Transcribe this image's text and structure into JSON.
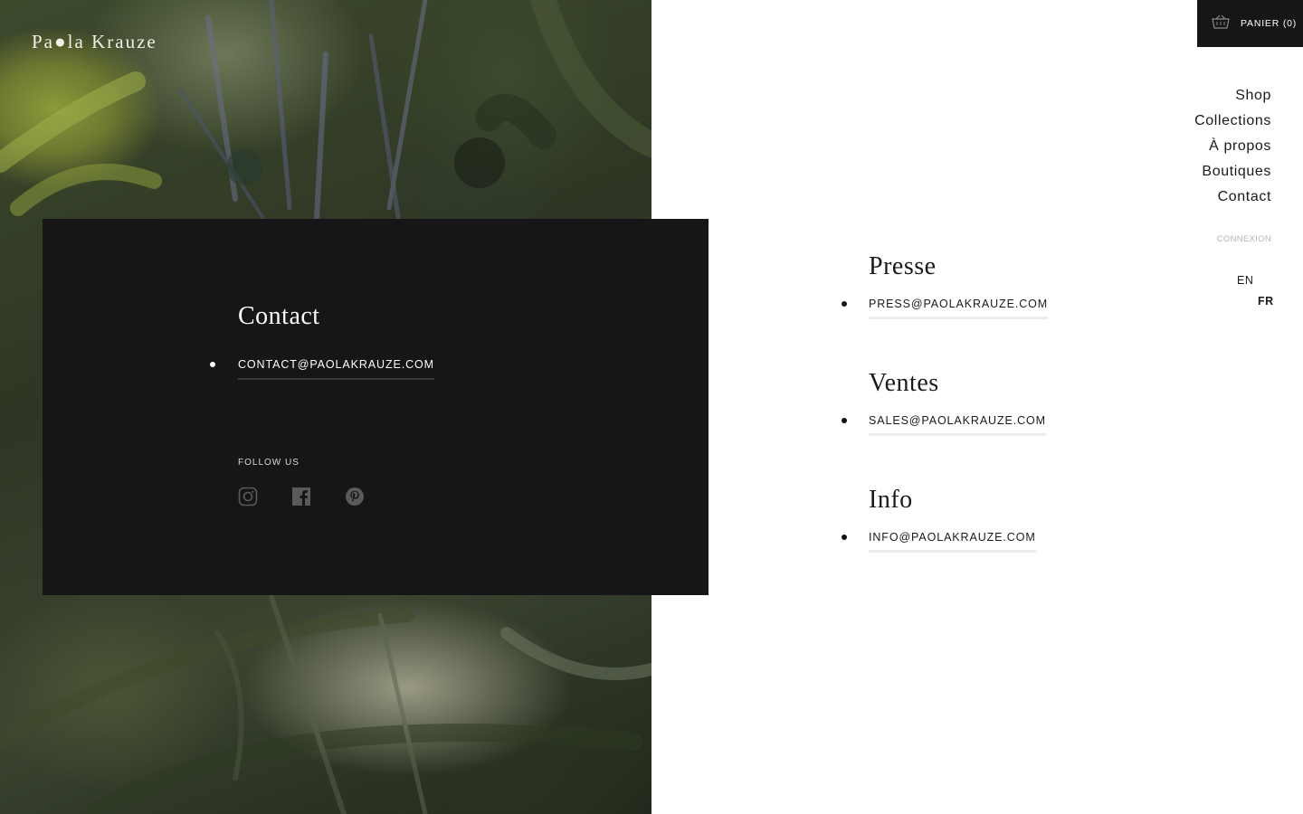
{
  "brand": {
    "logo_text": "Pa●la Krauze"
  },
  "cart": {
    "label": "PANIER (0)",
    "icon": "basket-icon"
  },
  "nav": {
    "items": [
      "Shop",
      "Collections",
      "À propos",
      "Boutiques",
      "Contact"
    ]
  },
  "account": {
    "login_label": "CONNEXION"
  },
  "languages": {
    "en": "EN",
    "fr": "FR",
    "active": "FR"
  },
  "contact_card": {
    "title": "Contact",
    "email": "CONTACT@PAOLAKRAUZE.COM",
    "follow_label": "FOLLOW US",
    "socials": [
      "instagram-icon",
      "facebook-icon",
      "pinterest-icon"
    ]
  },
  "sections": [
    {
      "title": "Presse",
      "email": "PRESS@PAOLAKRAUZE.COM"
    },
    {
      "title": "Ventes",
      "email": "SALES@PAOLAKRAUZE.COM"
    },
    {
      "title": "Info",
      "email": "INFO@PAOLAKRAUZE.COM"
    }
  ],
  "colors": {
    "card_bg": "#161618",
    "text_dark": "#1a1a1a",
    "muted": "#b3b3b3"
  }
}
